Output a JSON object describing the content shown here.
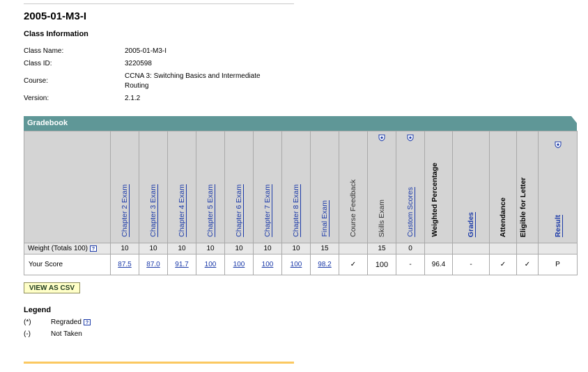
{
  "page_title": "2005-01-M3-I",
  "class_info": {
    "title": "Class Information",
    "rows": [
      {
        "label": "Class Name:",
        "value": "2005-01-M3-I"
      },
      {
        "label": "Class ID:",
        "value": "3220598"
      },
      {
        "label": "Course:",
        "value": "CCNA 3: Switching Basics and Intermediate Routing"
      },
      {
        "label": "Version:",
        "value": "2.1.2"
      }
    ]
  },
  "gradebook": {
    "title": "Gradebook",
    "columns": [
      {
        "label": "Chapter 2 Exam",
        "weight": "10",
        "score": "87.5"
      },
      {
        "label": "Chapter 3 Exam",
        "weight": "10",
        "score": "87.0"
      },
      {
        "label": "Chapter 4 Exam",
        "weight": "10",
        "score": "91.7"
      },
      {
        "label": "Chapter 5 Exam",
        "weight": "10",
        "score": "100"
      },
      {
        "label": "Chapter 6 Exam",
        "weight": "10",
        "score": "100"
      },
      {
        "label": "Chapter 7 Exam",
        "weight": "10",
        "score": "100"
      },
      {
        "label": "Chapter 8 Exam",
        "weight": "10",
        "score": "100"
      },
      {
        "label": "Final Exam",
        "weight": "15",
        "score": "98.2"
      },
      {
        "label": "Course Feedback",
        "weight": "",
        "score": "✓"
      },
      {
        "label": "Skills Exam",
        "weight": "15",
        "score": "100"
      },
      {
        "label": "Custom Scores",
        "weight": "0",
        "score": "-"
      },
      {
        "label": "Weighted Percentage",
        "weight": "",
        "score": "96.4"
      },
      {
        "label": "Grades",
        "weight": "",
        "score": "-"
      },
      {
        "label": "Attendance",
        "weight": "",
        "score": "✓"
      },
      {
        "label": "Eligible for Letter",
        "weight": "",
        "score": "✓"
      },
      {
        "label": "Result",
        "weight": "",
        "score": "P"
      }
    ],
    "weight_label": "Weight (Totals 100)",
    "score_label": "Your Score"
  },
  "csv_button": "VIEW AS CSV",
  "legend": {
    "title": "Legend",
    "items": [
      {
        "symbol": "(*)",
        "text": "Regraded"
      },
      {
        "symbol": "(-)",
        "text": "Not Taken"
      }
    ]
  },
  "icons": {
    "help": "help-icon",
    "shield": "shield-icon"
  },
  "colors": {
    "header_bar": "#5f9797",
    "link": "#1a39a8",
    "csv_button": "#ffffc8",
    "bottom_rule": "#fbc860"
  }
}
